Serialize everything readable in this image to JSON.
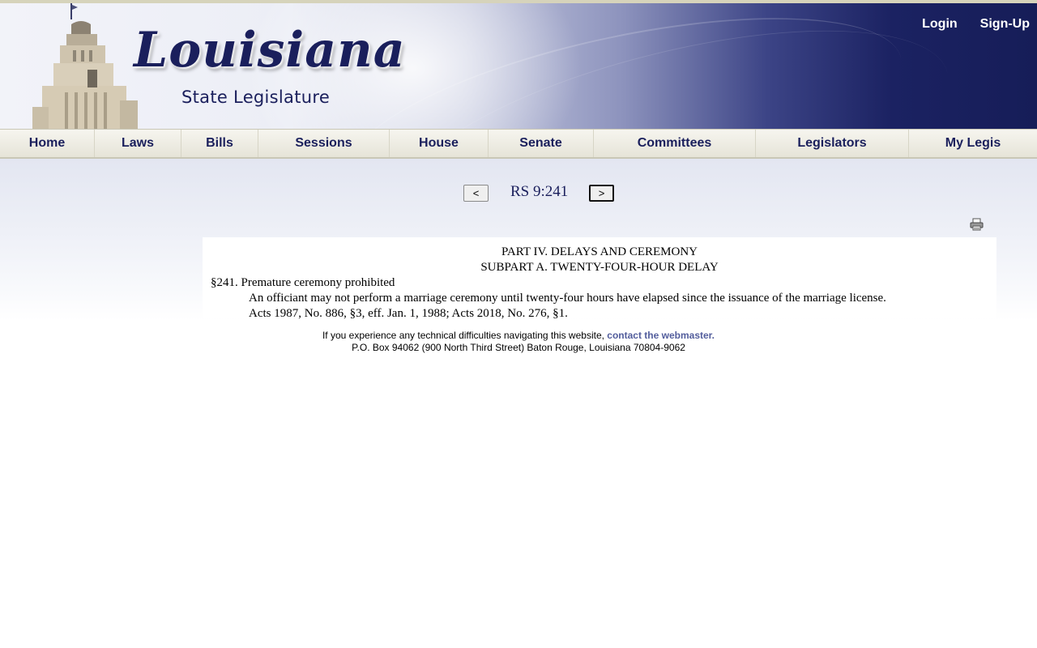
{
  "header": {
    "logo_title": "Louisiana",
    "logo_subtitle": "State Legislature",
    "login_label": "Login",
    "signup_label": "Sign-Up"
  },
  "nav": {
    "items": [
      "Home",
      "Laws",
      "Bills",
      "Sessions",
      "House",
      "Senate",
      "Committees",
      "Legislators",
      "My Legis"
    ]
  },
  "pager": {
    "prev_label": "<",
    "next_label": ">",
    "reference": "RS 9:241"
  },
  "document": {
    "part": "PART IV. DELAYS AND CEREMONY",
    "subpart": "SUBPART A. TWENTY-FOUR-HOUR DELAY",
    "section_heading": "§241. Premature ceremony prohibited",
    "body": "An officiant may not perform a marriage ceremony until twenty-four hours have elapsed since the issuance of the marriage license.",
    "history": "Acts 1987, No. 886, §3, eff. Jan. 1, 1988; Acts 2018, No. 276, §1."
  },
  "footer": {
    "text": "If you experience any technical difficulties navigating this website,",
    "link_label": "contact the webmaster.",
    "address": "P.O. Box 94062 (900 North Third Street) Baton Rouge, Louisiana 70804-9062"
  },
  "colors": {
    "navy": "#1a1f5c",
    "link": "#525d9c",
    "nav_bg": "#eceadf"
  },
  "icons": {
    "print": "print-icon",
    "building": "capitol-icon"
  }
}
